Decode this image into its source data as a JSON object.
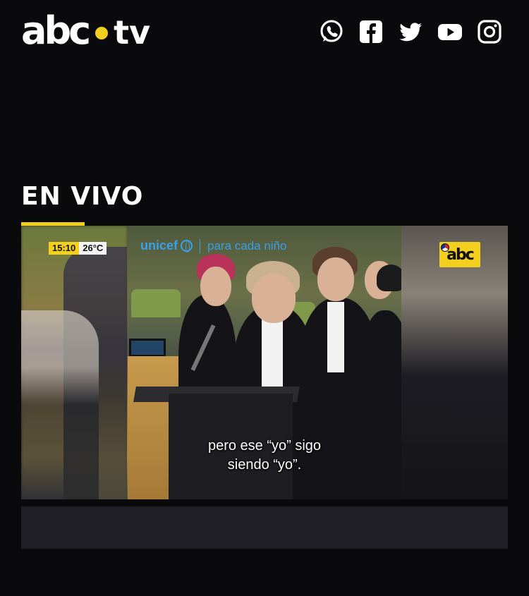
{
  "header": {
    "logo_primary": "abc",
    "logo_secondary": "tv",
    "social": [
      "whatsapp-icon",
      "facebook-icon",
      "twitter-icon",
      "youtube-icon",
      "instagram-icon"
    ]
  },
  "section": {
    "title": "EN VIVO"
  },
  "player": {
    "clock": {
      "time": "15:10",
      "temp": "26°C"
    },
    "unicef": {
      "brand": "unicef",
      "tagline": "para cada niño"
    },
    "subtitle_line1": "pero ese “yo” sigo",
    "subtitle_line2": "siendo “yo”.",
    "channel_badge": "abc"
  },
  "colors": {
    "accent": "#f3cf1e",
    "background": "#0a0a0c",
    "unicef_blue": "#3aa0e8"
  }
}
